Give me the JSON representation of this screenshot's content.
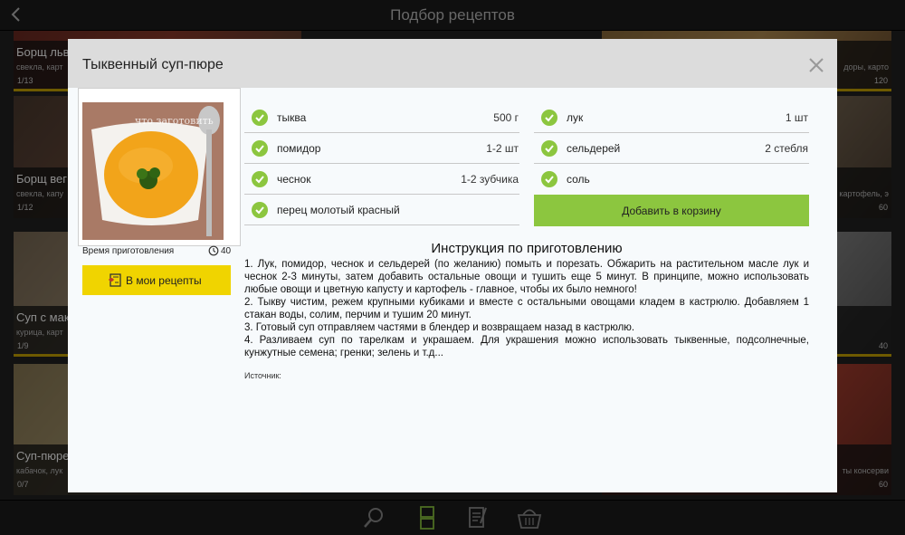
{
  "app": {
    "title": "Подбор рецептов"
  },
  "background_cards": [
    {
      "title": "Борщ льв",
      "sub": "свекла, карт",
      "count": "1/13"
    },
    {
      "title": "",
      "sub": "доры, карто",
      "count": "120"
    },
    {
      "title": "Борщ вег",
      "sub": "свекла, капу",
      "count": "1/12"
    },
    {
      "title": "",
      "sub": "картофель, э",
      "count": "60"
    },
    {
      "title": "Суп с мак",
      "sub": "курица, карт",
      "count": "1/9"
    },
    {
      "title": "",
      "sub": "",
      "count": "40"
    },
    {
      "title": "Суп-пюре",
      "sub": "кабачок, лук",
      "count": "0/7"
    },
    {
      "title": "",
      "sub": "ты консерви",
      "count": "60"
    }
  ],
  "recipe": {
    "title": "Тыквенный суп-пюре",
    "photo_watermark": "что заготовить",
    "time_label": "Время приготовления",
    "time_value": "40",
    "my_recipes_label": "В мои рецепты",
    "add_to_cart_label": "Добавить в корзину",
    "ingredients_left": [
      {
        "name": "тыква",
        "qty": "500 г"
      },
      {
        "name": "помидор",
        "qty": "1-2 шт"
      },
      {
        "name": "чеснок",
        "qty": "1-2 зубчика"
      },
      {
        "name": "перец молотый красный",
        "qty": ""
      }
    ],
    "ingredients_right": [
      {
        "name": "лук",
        "qty": "1 шт"
      },
      {
        "name": "сельдерей",
        "qty": "2 стебля"
      },
      {
        "name": "соль",
        "qty": ""
      }
    ],
    "instructions_title": "Инструкция по приготовлению",
    "instructions": [
      "1. Лук, помидор, чеснок и сельдерей (по желанию) помыть и порезать. Обжарить на растительном масле лук и чеснок 2-3 минуты, затем добавить остальные овощи и тушить еще 5 минут. В принципе, можно использовать любые овощи и цветную капусту и картофель - главное, чтобы их было немного!",
      "2. Тыкву чистим, режем крупными кубиками и вместе с остальными овощами кладем в кастрюлю. Добавляем 1 стакан воды, солим, перчим и тушим 20 минут.",
      "3. Готовый суп отправляем частями в блендер и возвращаем назад в кастрюлю.",
      "4. Разливаем суп по тарелкам и украшаем. Для украшения можно использовать тыквенные, подсолнечные, кунжутные семена; гренки; зелень и т.д..."
    ],
    "source_label": "Источник:"
  },
  "colors": {
    "accent_green": "#8cc63f",
    "accent_yellow": "#f0d400",
    "check_green": "#8cc63f"
  },
  "icons": [
    "back-icon",
    "close-icon",
    "check-icon",
    "timer-icon",
    "recipe-book-icon",
    "search-icon",
    "layout-icon",
    "notes-icon",
    "basket-icon"
  ]
}
